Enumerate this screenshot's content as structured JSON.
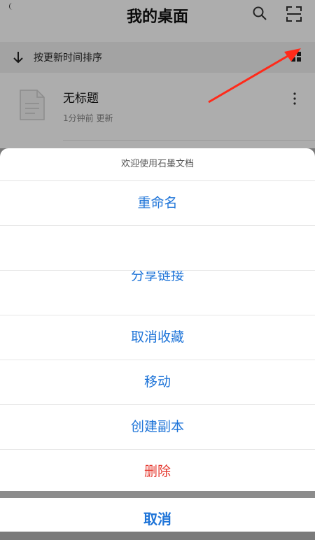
{
  "header": {
    "title": "我的桌面"
  },
  "sort": {
    "label": "按更新时间排序"
  },
  "document": {
    "name": "无标题",
    "meta": "1分钟前 更新"
  },
  "sheet": {
    "header": "欢迎使用石墨文档",
    "items": [
      {
        "label": "重命名"
      },
      {
        "label": ""
      },
      {
        "label": "分享链接"
      },
      {
        "label": "取消收藏"
      },
      {
        "label": "移动"
      },
      {
        "label": "创建副本"
      },
      {
        "label": "删除"
      }
    ],
    "cancel": "取消"
  },
  "colors": {
    "accent": "#1e74d8",
    "danger": "#e5392f",
    "annotation_arrow": "#ff2a1a"
  },
  "icons": [
    "search-icon",
    "scan-icon",
    "sort-arrow-icon",
    "grid-view-icon",
    "document-icon",
    "more-icon"
  ]
}
